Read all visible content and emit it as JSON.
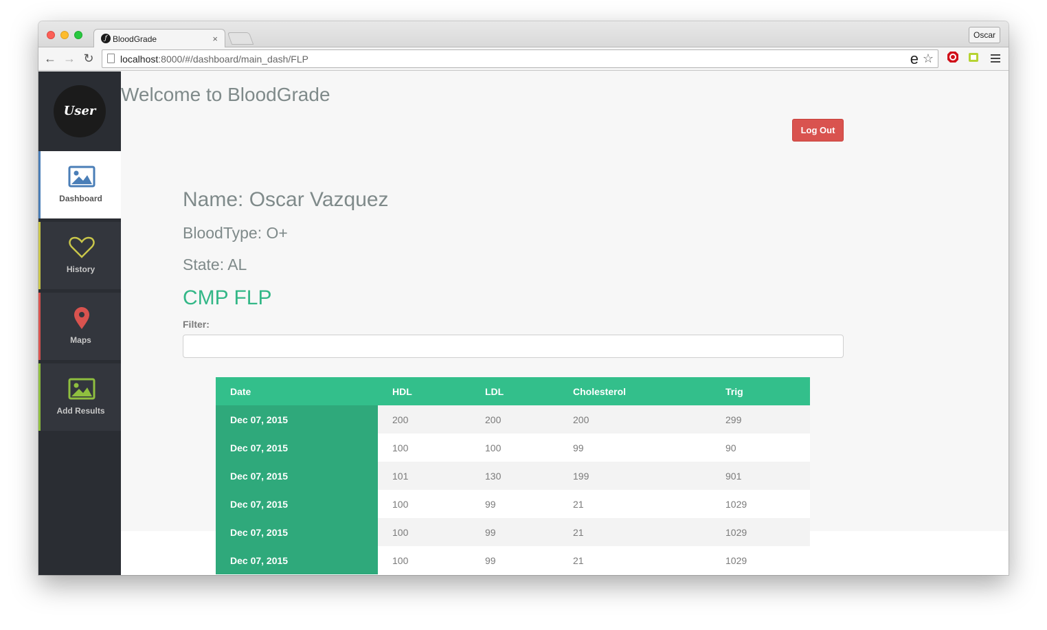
{
  "browser": {
    "tab_title": "BloodGrade",
    "tab_close": "×",
    "profile_name": "Oscar",
    "url_host": "localhost",
    "url_rest": ":8000/#/dashboard/main_dash/FLP"
  },
  "sidebar": {
    "avatar_text": "User",
    "items": [
      {
        "label": "Dashboard",
        "icon": "image-icon",
        "color": "#4a7eb7"
      },
      {
        "label": "History",
        "icon": "heart-icon",
        "color": "#c9c64a"
      },
      {
        "label": "Maps",
        "icon": "map-pin-icon",
        "color": "#d9534f"
      },
      {
        "label": "Add Results",
        "icon": "image-icon",
        "color": "#8fbf3f"
      }
    ]
  },
  "header": {
    "welcome": "Welcome to BloodGrade",
    "logout_label": "Log Out"
  },
  "profile": {
    "name": "Name: Oscar Vazquez",
    "bloodtype": "BloodType: O+",
    "state": "State: AL"
  },
  "results": {
    "title": "CMP FLP",
    "filter_label": "Filter:",
    "filter_value": "",
    "columns": [
      "Date",
      "HDL",
      "LDL",
      "Cholesterol",
      "Trig"
    ],
    "rows": [
      [
        "Dec 07, 2015",
        "200",
        "200",
        "200",
        "299"
      ],
      [
        "Dec 07, 2015",
        "100",
        "100",
        "99",
        "90"
      ],
      [
        "Dec 07, 2015",
        "101",
        "130",
        "199",
        "901"
      ],
      [
        "Dec 07, 2015",
        "100",
        "99",
        "21",
        "1029"
      ],
      [
        "Dec 07, 2015",
        "100",
        "99",
        "21",
        "1029"
      ],
      [
        "Dec 07, 2015",
        "100",
        "99",
        "21",
        "1029"
      ]
    ]
  },
  "colors": {
    "accent_green": "#33bf8b",
    "date_green": "#2fa97b",
    "logout_red": "#d9534f",
    "sidebar_bg": "#2a2d33"
  }
}
